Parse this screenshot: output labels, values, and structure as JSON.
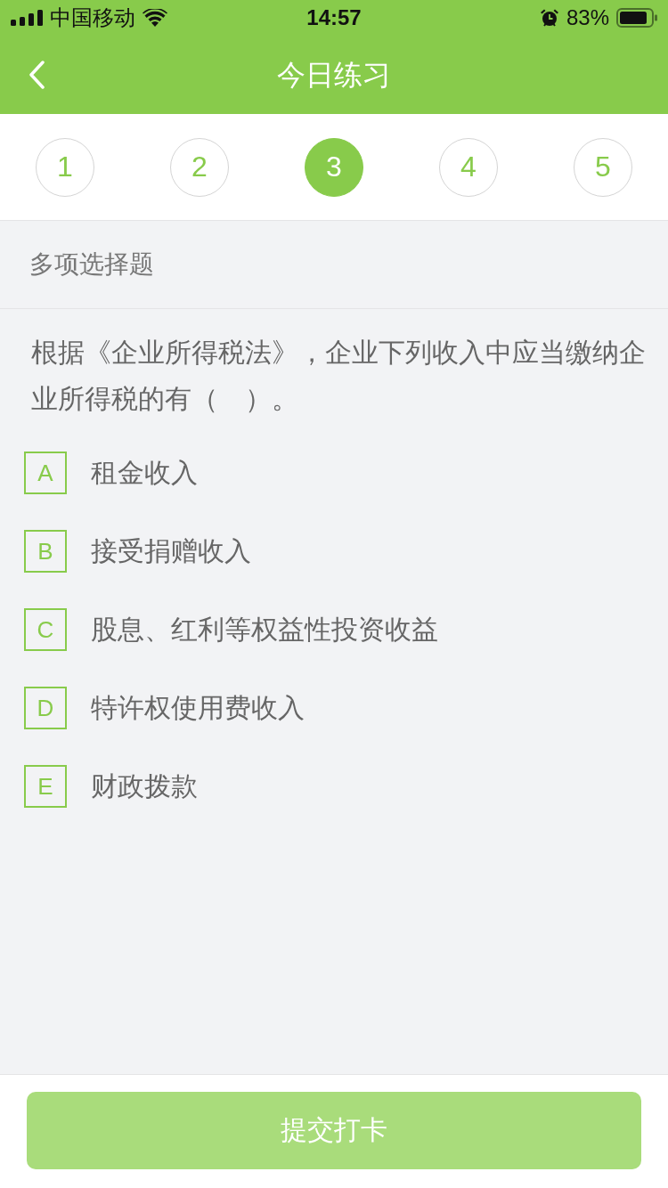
{
  "status_bar": {
    "carrier": "中国移动",
    "time": "14:57",
    "battery": "83%"
  },
  "nav_bar": {
    "title": "今日练习"
  },
  "steps": [
    {
      "label": "1",
      "selected": false
    },
    {
      "label": "2",
      "selected": false
    },
    {
      "label": "3",
      "selected": true
    },
    {
      "label": "4",
      "selected": false
    },
    {
      "label": "5",
      "selected": false
    }
  ],
  "question": {
    "type": "多项选择题",
    "text": "根据《企业所得税法》，企业下列收入中应当缴纳企业所得税的有（　）。",
    "options": [
      {
        "letter": "A",
        "text": "租金收入",
        "selected": false
      },
      {
        "letter": "B",
        "text": "接受捐赠收入",
        "selected": false
      },
      {
        "letter": "C",
        "text": "股息、红利等权益性投资收益",
        "selected": false
      },
      {
        "letter": "D",
        "text": "特许权使用费收入",
        "selected": false
      },
      {
        "letter": "E",
        "text": "财政拨款",
        "selected": false
      }
    ]
  },
  "submit_button": {
    "label": "提交打卡",
    "disabled": true
  }
}
